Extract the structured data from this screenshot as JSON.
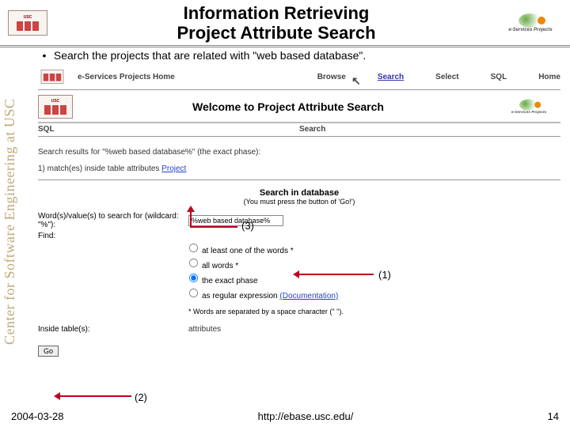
{
  "header": {
    "usc_label": "USC",
    "title_line1": "Information Retrieving",
    "title_line2": "Project Attribute Search",
    "es_label": "e-Services Projects",
    "es_sub": "Center for Software Engineering at USC"
  },
  "sidebar": {
    "text": "Center for Software Engineering at USC"
  },
  "bullet": {
    "marker": "•",
    "text": "Search the projects that are related with \"web based database\"."
  },
  "nav": {
    "home": "e-Services Projects Home",
    "browse": "Browse",
    "search": "Search",
    "select": "Select",
    "sql": "SQL",
    "main": "Home"
  },
  "sub": {
    "welcome": "Welcome to Project Attribute Search",
    "tab_sql": "SQL",
    "tab_search": "Search"
  },
  "results": {
    "line": "Search results for \"%web based database%\" (the exact phase):",
    "match_prefix": "1) match(es) inside table attributes ",
    "match_link": "Project"
  },
  "searchdb": {
    "title": "Search in database",
    "subtitle": "(You must press the button of 'Go!')",
    "words_label": "Word(s)/value(s) to search for (wildcard: \"%\"):",
    "words_value": "%web based database%",
    "find_label": "Find:",
    "opt1": "at least one of the words *",
    "opt2": "all words *",
    "opt3": "the exact phase",
    "opt4_prefix": "as regular expression ",
    "opt4_link": "(Documentation)",
    "note": "* Words are separated by a space character (\" \").",
    "inside_label": "Inside table(s):",
    "inside_value": "attributes",
    "go": "Go"
  },
  "annotations": {
    "a1": "(1)",
    "a2": "(2)",
    "a3": "(3)"
  },
  "footer": {
    "date": "2004-03-28",
    "url": "http://ebase.usc.edu/",
    "page": "14"
  }
}
